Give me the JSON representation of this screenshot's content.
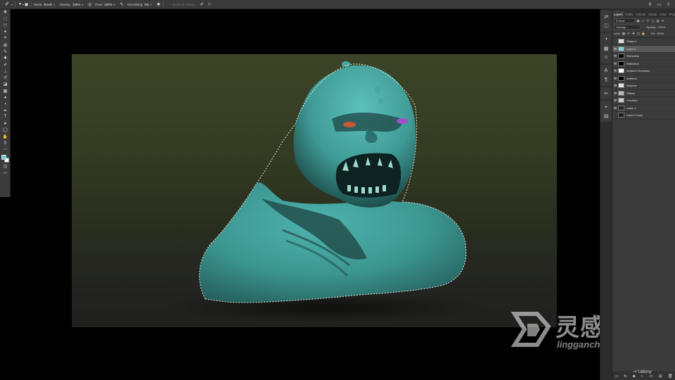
{
  "options_bar": {
    "mode_label": "Mode:",
    "mode_value": "Brush",
    "opacity_label": "Opacity:",
    "opacity_value": "100%",
    "flow_label": "Flow:",
    "flow_value": "100%",
    "smoothing_label": "Smoothing:",
    "smoothing_value": "0%",
    "erase_history_label": "Erase to History",
    "icons": [
      "brush-preset-icon",
      "brush-settings-icon",
      "pressure-opacity-icon",
      "airbrush-icon",
      "pressure-size-icon",
      "gear-icon",
      "search-icon",
      "workspace-icon",
      "share-icon"
    ]
  },
  "toolbar": {
    "tools": [
      {
        "name": "move-tool",
        "glyph": "✥"
      },
      {
        "name": "marquee-tool",
        "glyph": "⬚"
      },
      {
        "name": "lasso-tool",
        "glyph": "➰"
      },
      {
        "name": "magic-wand-tool",
        "glyph": "✦"
      },
      {
        "name": "crop-tool",
        "glyph": "⌗"
      },
      {
        "name": "frame-tool",
        "glyph": "⊠"
      },
      {
        "name": "eyedropper-tool",
        "glyph": "✎"
      },
      {
        "name": "healing-brush-tool",
        "glyph": "✚"
      },
      {
        "name": "brush-tool",
        "glyph": "✐"
      },
      {
        "name": "clone-stamp-tool",
        "glyph": "⊥"
      },
      {
        "name": "history-brush-tool",
        "glyph": "↺"
      },
      {
        "name": "eraser-tool",
        "glyph": "◪"
      },
      {
        "name": "gradient-tool",
        "glyph": "▦"
      },
      {
        "name": "blur-tool",
        "glyph": "●"
      },
      {
        "name": "dodge-tool",
        "glyph": "◖"
      },
      {
        "name": "pen-tool",
        "glyph": "✒"
      },
      {
        "name": "type-tool",
        "glyph": "T"
      },
      {
        "name": "path-selection-tool",
        "glyph": "➤"
      },
      {
        "name": "ellipse-tool",
        "glyph": "◯"
      },
      {
        "name": "hand-tool",
        "glyph": "✋"
      },
      {
        "name": "zoom-tool",
        "glyph": "⚲"
      },
      {
        "name": "more-tools",
        "glyph": "⋯"
      }
    ],
    "colors": {
      "foreground": "#5bd4db",
      "background": "#ffffff"
    },
    "bottom_tools": [
      {
        "name": "quick-mask-tool",
        "glyph": "◫"
      },
      {
        "name": "screen-mode-tool",
        "glyph": "▭"
      }
    ]
  },
  "layers_panel": {
    "tabs": [
      "Layers",
      "Paths",
      "Actions",
      "Chann",
      "Char",
      "Proper"
    ],
    "filter_label": "Kind",
    "blend_mode": "Overlay",
    "opacity_label": "Opacity:",
    "opacity_value": "100%",
    "lock_label": "Lock:",
    "fill_label": "Fill:",
    "fill_value": "100%",
    "layers": [
      {
        "name": "Shape 1",
        "thumb": "#dddddd",
        "visible": false,
        "selected": false
      },
      {
        "name": "Layer 2",
        "thumb": "#7fd8e0",
        "visible": true,
        "selected": true
      },
      {
        "name": "Refraction",
        "thumb": "#000000",
        "visible": true,
        "selected": false
      },
      {
        "name": "Reflection",
        "thumb": "#000000",
        "visible": true,
        "selected": false
      },
      {
        "name": "Ambient Occlusion",
        "thumb": "#ffffff",
        "visible": true,
        "selected": false
      },
      {
        "name": "Ambient",
        "thumb": "#000000",
        "visible": true,
        "selected": false
      },
      {
        "name": "Shadow",
        "thumb": "#e0e0e0",
        "visible": true,
        "selected": false
      },
      {
        "name": "Diffuse",
        "thumb": "#bbbbbb",
        "visible": true,
        "selected": false
      },
      {
        "name": "Creature",
        "thumb": "#cccccc",
        "visible": true,
        "selected": false
      },
      {
        "name": "Layer 1",
        "thumb": "#262626",
        "visible": true,
        "selected": false
      },
      {
        "name": "Layer 0 copy",
        "thumb": "#1c1c1c",
        "visible": false,
        "selected": false
      }
    ],
    "footer_icons": [
      {
        "name": "link-layers-icon",
        "glyph": "∞"
      },
      {
        "name": "layer-style-icon",
        "glyph": "fx"
      },
      {
        "name": "add-mask-icon",
        "glyph": "◙"
      },
      {
        "name": "adjustment-layer-icon",
        "glyph": "◐"
      },
      {
        "name": "new-group-icon",
        "glyph": "▭"
      },
      {
        "name": "new-layer-icon",
        "glyph": "⊞"
      },
      {
        "name": "trash-icon",
        "glyph": "🗑"
      }
    ]
  },
  "mini_panels": [
    {
      "name": "history-panel-icon",
      "glyph": "⇄"
    },
    {
      "name": "info-panel-icon",
      "glyph": "ⓘ"
    },
    {
      "name": "color-panel-icon",
      "glyph": "◑"
    },
    {
      "name": "swatches-panel-icon",
      "glyph": "▦"
    },
    {
      "name": "user-panel-icon",
      "glyph": "☺"
    },
    {
      "name": "character-panel-icon",
      "glyph": "A"
    },
    {
      "name": "paragraph-panel-icon",
      "glyph": "¶"
    },
    {
      "name": "tools-panel-icon",
      "glyph": "✂"
    },
    {
      "name": "adjustments-panel-icon",
      "glyph": "◒"
    },
    {
      "name": "libraries-panel-icon",
      "glyph": "▤"
    }
  ],
  "watermark": {
    "chinese": "灵感中国",
    "url": "lingganchina.com"
  },
  "udemy": {
    "label": "Udemy"
  }
}
